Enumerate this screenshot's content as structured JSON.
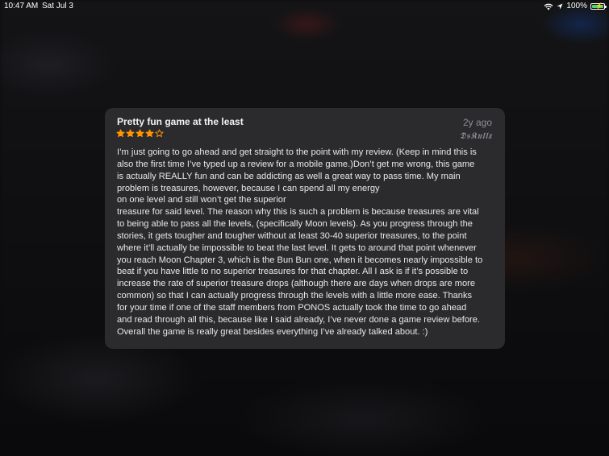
{
  "status_bar": {
    "time": "10:47 AM",
    "date": "Sat Jul 3",
    "battery_percent": "100%",
    "battery_level": 1.0,
    "icons": [
      "wifi-icon",
      "location-icon",
      "battery-charging-icon"
    ]
  },
  "review": {
    "title": "Pretty fun game at the least",
    "date": "2y ago",
    "author": "𝕯𝖘𝕶𝖚𝖑𝖑𝖝",
    "rating": 4,
    "rating_max": 5,
    "star_color": "#ff9500",
    "body": "I’m just going to go ahead and get straight to the point with my review. (Keep in mind this is\nalso the first time I’ve typed up a review for a mobile game.)Don’t get me wrong, this game\nis actually REALLY fun and can be addicting as well a great way to pass time. My main\nproblem is treasures, however, because I can spend all my energy\non one level and still won’t get the superior\ntreasure for said level. The reason why this is such a problem is because treasures are vital\nto being able to pass all the levels, (specifically Moon levels). As you progress through the\nstories, it gets tougher and tougher without at least 30-40 superior treasures, to the point\nwhere it’ll actually be impossible to beat the last level. It gets to around that point whenever\nyou reach Moon Chapter 3, which is the Bun Bun one, when it becomes nearly impossible to\nbeat if you have little to no superior treasures for that chapter. All I ask is if it’s possible to\nincrease the rate of superior treasure drops (although there are days when drops are more\ncommon) so that I can actually progress through the levels with a little more ease. Thanks\nfor your time if one of the staff members from PONOS actually took the time to go ahead\nand read through all this, because like I said already, I’ve never done a game review before.\nOverall the game is really great besides everything I’ve already talked about. :)"
  }
}
